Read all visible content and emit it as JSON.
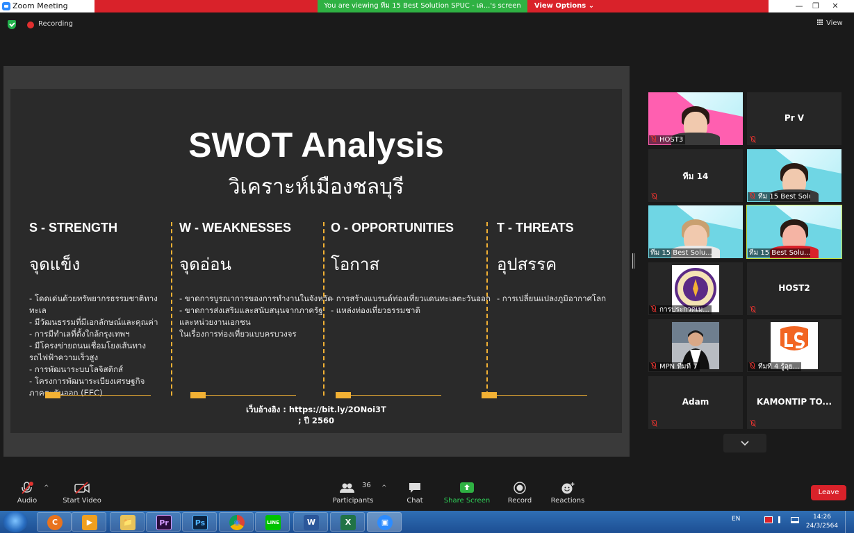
{
  "window": {
    "title": "Zoom Meeting",
    "sharing_banner": "You are viewing ทีม 15 Best Solution SPUC - เด...'s screen",
    "view_options": "View Options ⌄",
    "minimize": "—",
    "restore": "❐",
    "close": "✕"
  },
  "meeting": {
    "recording_label": "Recording",
    "view_label": "View"
  },
  "slide": {
    "title": "SWOT Analysis",
    "subtitle": "วิเคราะห์เมืองชลบุรี",
    "columns": [
      {
        "head": "S - STRENGTH",
        "thai": "จุดแข็ง",
        "items": [
          "- โดดเด่นด้วยทรัพยากรธรรมชาติทาง",
          "ทะเล",
          "- มีวัฒนธรรมที่มีเอกลักษณ์และคุณค่า",
          "- การมีทำเลที่ตั้งใกล้กรุงเทพฯ",
          "- มีโครงข่ายถนนเชื่อมโยงเส้นทาง",
          "รถไฟฟ้าความเร็วสูง",
          "- การพัฒนาระบบโลจิสติกส์",
          "- โครงการพัฒนาระเบียงเศรษฐกิจ",
          "ภาคตะวันออก (EEC)"
        ]
      },
      {
        "head": "W - WEAKNESSES",
        "thai": "จุดอ่อน",
        "items": [
          "- ขาดการบูรณาการของการทำงานในจังหวัด",
          "- ขาดการส่งเสริมและสนับสนุนจากภาครัฐ",
          "และหน่วยงานเอกชน",
          "ในเรื่องการท่องเที่ยวแบบครบวงจร"
        ]
      },
      {
        "head": "O - OPPORTUNITIES",
        "thai": "โอกาส",
        "items": [
          "- การสร้างแบรนด์ท่องเที่ยวแดนทะเลตะวันออก",
          "- แหล่งท่องเที่ยวธรรมชาติ"
        ]
      },
      {
        "head": "T - THREATS",
        "thai": "อุปสรรค",
        "items": [
          "- การเปลี่ยนแปลงภูมิอากาศโลก"
        ]
      }
    ],
    "source_line1": "เว็บอ้างอิง : https://bit.ly/2ONoi3T",
    "source_line2": "; ปี 2560"
  },
  "participants": [
    {
      "name": "HOST3",
      "kind": "video-pink"
    },
    {
      "name": "Pr V",
      "kind": "name"
    },
    {
      "name": "ทีม 14",
      "kind": "name"
    },
    {
      "name": "ทีม 15 Best Solu...",
      "kind": "video"
    },
    {
      "name": "ทีม 15 Best Solu...",
      "kind": "video"
    },
    {
      "name": "ทีม 15 Best Solu...",
      "kind": "video-active"
    },
    {
      "name": "การประกวดเม...",
      "kind": "logo-seal"
    },
    {
      "name": "HOST2",
      "kind": "name"
    },
    {
      "name": "MPN ทีมที่ 7",
      "kind": "photo"
    },
    {
      "name": "ทีมที่ 4 รู้ลุย...",
      "kind": "logo-ls"
    },
    {
      "name": "Adam",
      "kind": "name"
    },
    {
      "name": "KAMONTIP TO...",
      "kind": "name"
    }
  ],
  "toolbar": {
    "audio": "Audio",
    "start_video": "Start Video",
    "participants": "Participants",
    "participant_count": "36",
    "chat": "Chat",
    "share_screen": "Share Screen",
    "record": "Record",
    "reactions": "Reactions",
    "leave": "Leave"
  },
  "taskbar": {
    "lang": "EN",
    "time": "14:26",
    "date": "24/3/2564",
    "apps": [
      "C",
      "▶",
      "📁",
      "Pr",
      "Ps",
      "◉",
      "LINE",
      "W",
      "X",
      "▣"
    ]
  },
  "colors": {
    "accent_gold": "#f2b134",
    "active_speaker": "#c7e342",
    "leave_red": "#d9222a",
    "share_green": "#2fb143"
  }
}
